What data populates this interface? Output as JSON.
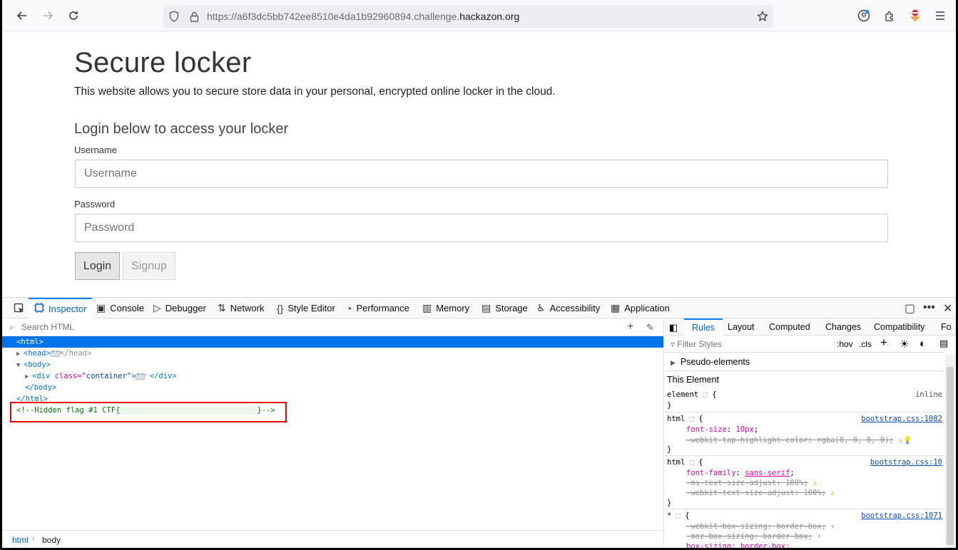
{
  "browser": {
    "url_prefix": "https://a6f3dc5bb742ee8510e4da1b92960894.challenge.",
    "url_domain": "hackazon.org"
  },
  "page": {
    "title": "Secure locker",
    "lead": "This website allows you to secure store data in your personal, encrypted online locker in the cloud.",
    "subtitle": "Login below to access your locker",
    "username_label": "Username",
    "username_placeholder": "Username",
    "password_label": "Password",
    "password_placeholder": "Password",
    "login_label": "Login",
    "signup_label": "Signup"
  },
  "devtools": {
    "tabs": [
      "Inspector",
      "Console",
      "Debugger",
      "Network",
      "Style Editor",
      "Performance",
      "Memory",
      "Storage",
      "Accessibility",
      "Application"
    ],
    "search_placeholder": "Search HTML",
    "tree": {
      "html_open": "<html>",
      "head": "<head>",
      "head_close": "</head>",
      "body": "<body>",
      "div_open": "<div",
      "div_attr": "class=",
      "div_val": "\"container\"",
      "div_gt": ">",
      "div_close": "</div>",
      "body_close": "</body>",
      "html_close": "</html>",
      "comment_start": "<!--Hidden flag #1 CTF{",
      "comment_end": "}-->"
    },
    "breadcrumbs": [
      "html",
      "body"
    ],
    "rules_tabs": [
      "Rules",
      "Layout",
      "Computed",
      "Changes",
      "Compatibility",
      "Fo"
    ],
    "filter_placeholder": "Filter Styles",
    "hov": ":hov",
    "cls": ".cls",
    "pseudo": "Pseudo-elements",
    "this_element": "This Element",
    "rules": {
      "element_sel": "element",
      "inline": "inline",
      "r1_sel": "html",
      "r1_src": "bootstrap.css:1082",
      "r1_p1": "font-size",
      "r1_v1": "10px",
      "r1_p2": "-webkit-tap-highlight-color: rgba(0, 0, 0, 0);",
      "r2_sel": "html",
      "r2_src": "bootstrap.css:10",
      "r2_p1": "font-family",
      "r2_v1": "sans-serif",
      "r2_p2": "-ms-text-size-adjust: 100%;",
      "r2_p3": "-webkit-text-size-adjust: 100%;",
      "r3_sel": "*",
      "r3_src": "bootstrap.css:1071",
      "r3_p1": "-webkit-box-sizing: ",
      "r3_v1": "border-box;",
      "r3_p2": "-moz-box-sizing: ",
      "r3_v2": "border-box;",
      "r3_p3": "box-sizing: border-box;"
    }
  }
}
